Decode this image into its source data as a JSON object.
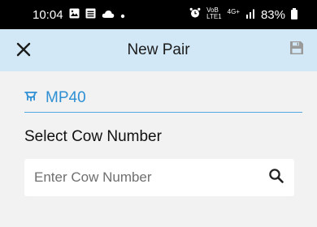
{
  "status_bar": {
    "time": "10:04",
    "network_top": "VoB",
    "network_bottom": "LTE1",
    "network_gen": "4G+",
    "battery": "83%",
    "left_icons": [
      "gallery-icon",
      "message-icon",
      "cloud-icon",
      "dot-icon"
    ],
    "right_icons": [
      "alarm-icon",
      "signal-icon",
      "battery-icon"
    ]
  },
  "app_bar": {
    "title": "New Pair",
    "close_icon": "close-icon",
    "save_icon": "save-icon",
    "background": "#d3e8f6"
  },
  "pair": {
    "label": "MP40",
    "icon": "udder-icon",
    "color": "#2e8fd4"
  },
  "cow_section": {
    "label": "Select Cow Number",
    "search": {
      "placeholder": "Enter Cow Number",
      "value": "",
      "icon": "search-icon"
    }
  }
}
